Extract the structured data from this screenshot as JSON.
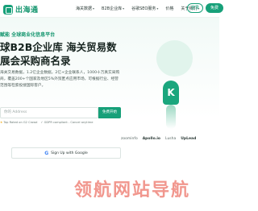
{
  "header": {
    "logo_text": "出海通",
    "nav": [
      {
        "label": "海关数据",
        "has_caret": true
      },
      {
        "label": "B2B企业库",
        "has_caret": true
      },
      {
        "label": "谷歌SEO服务",
        "has_caret": true
      },
      {
        "label": "价格",
        "has_caret": false
      },
      {
        "label": "关于我们",
        "has_caret": true
      }
    ],
    "login_label": "登录",
    "register_label": "免费"
  },
  "hero": {
    "tagline": "赋能 全球商业化信息平台",
    "title_line1": "球B2B企业库 海关贸易数",
    "title_line2": "展会采购商名录",
    "description": "海关交易数据，1.2亿企业数据，2亿+企业联系人，1000十万真实采购商，覆盖200+个国家及地区5%外贸匿点应用市场，可根据行业、经营范围等检索投搜国际客户。",
    "email_placeholder": "你的 Address",
    "start_label": "免费开始",
    "trust_items": [
      "Top Rated on G2 Crowd",
      "GDPR compliant - Cancel anytime"
    ],
    "google_label": "Sign Up with Google"
  },
  "partners": [
    "zoominfo",
    "Apollo.io",
    "Lusha",
    "UpLead"
  ],
  "rocket": {
    "letter": "K"
  },
  "watermark": "领航网站导航",
  "colors": {
    "brand": "#17a079",
    "watermark": "#f08c82"
  }
}
